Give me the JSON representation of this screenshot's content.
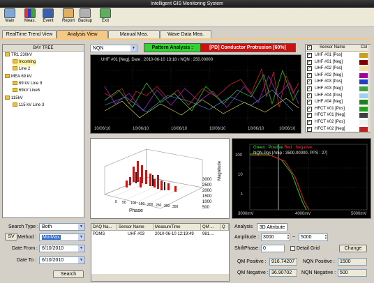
{
  "window": {
    "title": "Intelligent GIS Monitoring System"
  },
  "toolbar": {
    "main": "Main",
    "meas": "Meas.",
    "event": "Event",
    "report": "Report",
    "backup": "Backup",
    "exit": "Exit"
  },
  "tabs": [
    "RealTime Trend View",
    "Analysis View",
    "Manual Mea.",
    "Wave Data Mea."
  ],
  "tree": {
    "header": "BAY TREE",
    "nodes": [
      "TR1 230kV",
      "Incoming",
      "Line 2",
      "MEA 69 kV",
      "69 kV Line 9",
      "69kV Line6",
      "115kV",
      "115 kV Line 3"
    ]
  },
  "filter": {
    "search_type_label": "Search Type :",
    "search_type_value": "Both",
    "sv_label": "SV",
    "method_label": "Method :",
    "method_value": "MinMax",
    "date_from_label": "Date From :",
    "date_from_value": "6/10/2010",
    "date_to_label": "Date To :",
    "date_to_value": "6/10/2010",
    "search_label": "Search"
  },
  "analysis": {
    "sensor_select": "NQN",
    "pattern_label": "Pattern Analysis :",
    "pattern_value": "[PD]  Conductor Protrusion [60%]"
  },
  "trend": {
    "caption": "UHF #01 [Neg], Date : 2010-06-10 13:18 / NQN : 250.00000",
    "x_ticks": [
      "10/06/10",
      "10/06/10",
      "10/06/10",
      "10/06/10",
      "10/06/10",
      "10/06/10"
    ]
  },
  "sensors": {
    "header": "Sensor Name",
    "col_header": "Col",
    "rows": [
      {
        "name": "UHF #01 [Pos]",
        "color": "#c8a020"
      },
      {
        "name": "UHF #01 [Neg]",
        "color": "#800000"
      },
      {
        "name": "UHF #02 [Pos]",
        "color": "#f0e0a0"
      },
      {
        "name": "UHF #02 [Neg]",
        "color": "#a000a0"
      },
      {
        "name": "UHF #03 [Pos]",
        "color": "#2040c0"
      },
      {
        "name": "UHF #03 [Neg]",
        "color": "#40a040"
      },
      {
        "name": "UHF #04 [Pos]",
        "color": "#a0d0f0"
      },
      {
        "name": "UHF #04 [Neg]",
        "color": "#208020"
      },
      {
        "name": "HFCT #01 [Pos]",
        "color": "#20a020"
      },
      {
        "name": "HFCT #01 [Neg]",
        "color": "#404040"
      },
      {
        "name": "HFCT #02 [Pos]",
        "color": "#f0f0f0"
      },
      {
        "name": "HFCT #02 [Neg]",
        "color": "#c02020"
      }
    ]
  },
  "prpd": {
    "y_ticks": [
      "3000",
      "2500",
      "2000",
      "1500",
      "1000",
      "500"
    ],
    "x_ticks": [
      "0",
      "50",
      "100",
      "150",
      "200",
      "250",
      "300",
      "350"
    ],
    "axis_phase": "Phase",
    "axis_mag": "Magnitude"
  },
  "nqn": {
    "legend_green": "Green : Positive",
    "legend_red": "Red : Negative",
    "info": "NQN Pos [Amp : 3500.00000, PPS : 27]",
    "y_ticks": [
      "100",
      "10",
      "1"
    ],
    "x_ticks": [
      "3000mV",
      "4000mV",
      "5000mV"
    ]
  },
  "grid": {
    "headers": [
      "DAQ Na...",
      "Sensor Name",
      "MeasureTime",
      "QM ...",
      "Q"
    ],
    "row": [
      "PDMS",
      "UHF #03",
      "2010-06-10 12:19:49",
      "981....",
      ""
    ]
  },
  "attr": {
    "tab_analysis": "Analysis",
    "tab_3d": "3D Attribute",
    "amplitude_label": "Amplitude :",
    "amp_from": "3000",
    "amp_sep": "~",
    "amp_to": "5000",
    "shift_label": "ShiftPhase :",
    "shift_value": "0",
    "detail_grid": "Detail Grid",
    "change": "Change",
    "qm_pos_label": "QM Positive :",
    "qm_pos": "916.74207",
    "nqn_pos_label": "NQN Positive :",
    "nqn_pos": "1500",
    "qm_neg_label": "QM Negative :",
    "qm_neg": "36.90702",
    "nqn_neg_label": "NQN Negative :",
    "nqn_neg": "500"
  }
}
